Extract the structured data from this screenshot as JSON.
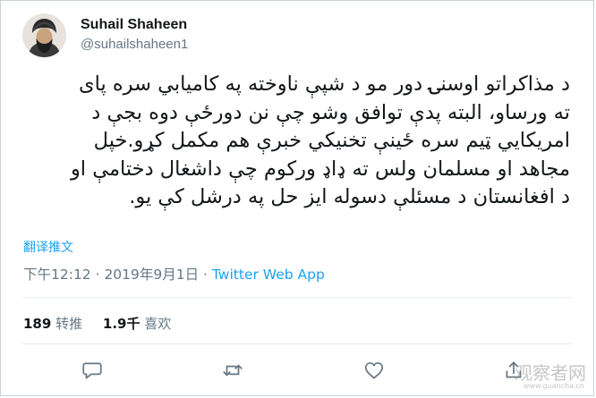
{
  "tweet": {
    "author": {
      "display_name": "Suhail Shaheen",
      "handle": "@suhailshaheen1"
    },
    "body_lines": [
      "د مذاکراتو اوسنۍ دور مو د شپې ناوخته په کاميابي سره پای",
      "ته ورساو، البته پدې توافق وشو چې نن دورځې دوه بجې د",
      "امريکايي ټيم سره ځينې تخنيکي خبرې هم مکمل کړو.خپل",
      "مجاهد او مسلمان ولس ته ډاډ ورکوم چې داشغال دختامې او",
      "د افغانستان د مسئلې دسوله ايز حل په درشل کې يو."
    ],
    "translate_label": "翻译推文",
    "timestamp": "下午12:12 · 2019年9月1日",
    "separator": " · ",
    "source_app": "Twitter Web App",
    "stats": {
      "retweets": {
        "count": "189",
        "label": "转推"
      },
      "likes": {
        "count": "1.9千",
        "label": "喜欢"
      }
    }
  },
  "icons": {
    "reply": "speech-bubble-icon",
    "retweet": "retweet-arrows-icon",
    "like": "heart-icon",
    "share": "share-upload-icon"
  },
  "watermark": {
    "text": "观察者网",
    "subtext": "www.guancha.cn"
  },
  "colors": {
    "accent": "#1da1f2",
    "secondary_text": "#657786",
    "divider": "#e6ecf0"
  }
}
